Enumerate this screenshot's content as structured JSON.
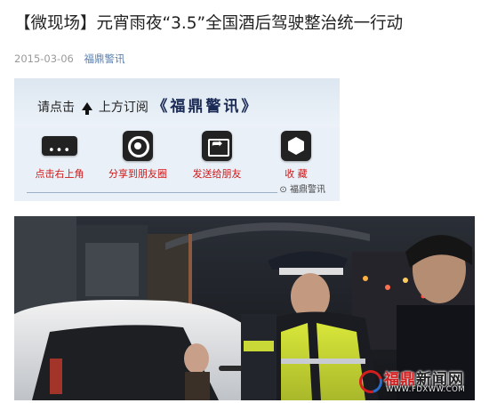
{
  "article": {
    "title": "【微现场】元宵雨夜“3.5”全国酒后驾驶整治统一行动",
    "date": "2015-03-06",
    "account": "福鼎警讯"
  },
  "banner": {
    "prompt_before": "请点击",
    "prompt_after": "上方订阅",
    "brand": "《福鼎警讯》",
    "options": [
      {
        "label": "点击右上角",
        "icon": "more-dots-icon"
      },
      {
        "label": "分享到朋友圈",
        "icon": "moments-camera-icon"
      },
      {
        "label": "发送给朋友",
        "icon": "forward-share-icon"
      },
      {
        "label": "收  藏",
        "icon": "favorite-cube-icon"
      }
    ],
    "watermark": "福鼎警讯"
  },
  "photo": {
    "alt_subject": "traffic police breathalyzer check at night in the rain",
    "logo_name_red": "福鼎",
    "logo_name_dark": "新闻网",
    "logo_url": "WWW.FDXWW.COM"
  },
  "colors": {
    "accent_red": "#d01818",
    "link_blue": "#5a7fae",
    "banner_bg": "#e9f0f7"
  }
}
